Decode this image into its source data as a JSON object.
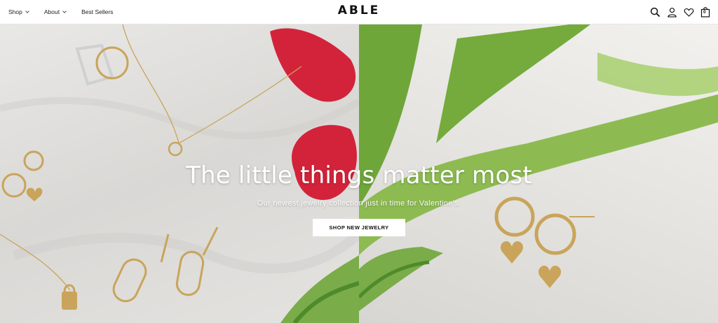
{
  "header": {
    "nav": [
      {
        "label": "Shop",
        "has_dropdown": true
      },
      {
        "label": "About",
        "has_dropdown": true
      },
      {
        "label": "Best Sellers",
        "has_dropdown": false
      }
    ],
    "logo": "ABLE",
    "icons": [
      "search-icon",
      "account-icon",
      "wishlist-heart-icon",
      "cart-bag-icon"
    ],
    "cart_count": "0"
  },
  "hero": {
    "headline": "The little things matter most",
    "subline": "Our newest jewelry collection just in time for Valentine's.",
    "cta_label": "SHOP NEW JEWELRY"
  },
  "colors": {
    "cta_background": "#ffffff",
    "headline_text": "#ffffff",
    "tulip_red": "#d3233a",
    "leaf_green": "#6fa63a",
    "gold": "#c9a45a"
  }
}
